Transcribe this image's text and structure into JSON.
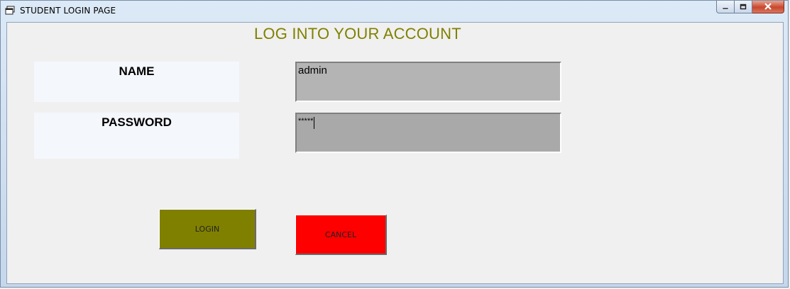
{
  "window": {
    "title": "STUDENT LOGIN PAGE",
    "controls": {
      "minimize_icon": "minimize-icon",
      "maximize_icon": "maximize-icon",
      "close_icon": "close-icon"
    }
  },
  "form": {
    "heading": "LOG INTO YOUR ACCOUNT",
    "heading_color": "#808000",
    "name_label": "NAME",
    "name_value": "admin",
    "password_label": "PASSWORD",
    "password_value": "*****",
    "login_label": "LOGIN",
    "login_color": "#808000",
    "cancel_label": "CANCEL",
    "cancel_color": "#ff0000"
  }
}
